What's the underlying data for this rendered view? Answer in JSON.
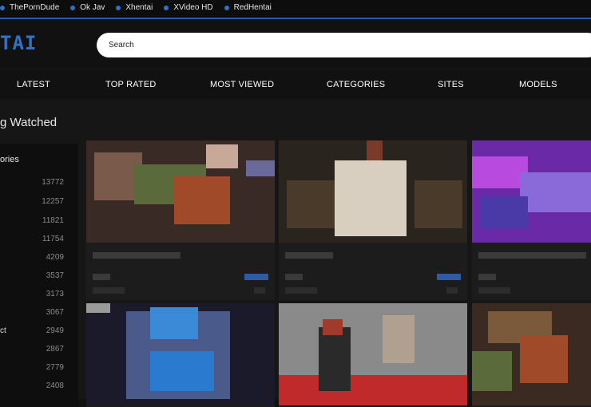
{
  "top_links": [
    "ThePornDude",
    "Ok Jav",
    "Xhentai",
    "XVideo HD",
    "RedHentai"
  ],
  "logo": "TAI",
  "search": {
    "placeholder": "Search"
  },
  "nav": [
    "LATEST",
    "TOP RATED",
    "MOST VIEWED",
    "CATEGORIES",
    "SITES",
    "MODELS"
  ],
  "section_title": "g Watched",
  "sidebar": {
    "title": "ories",
    "rows": [
      {
        "label": "",
        "count": "13772"
      },
      {
        "label": "",
        "count": "12257"
      },
      {
        "label": "",
        "count": "11821"
      },
      {
        "label": "",
        "count": "11754"
      },
      {
        "label": "",
        "count": "4209"
      },
      {
        "label": "",
        "count": "3537"
      },
      {
        "label": "",
        "count": "3173"
      },
      {
        "label": "",
        "count": "3067"
      },
      {
        "label": "ct",
        "count": "2949"
      },
      {
        "label": "",
        "count": "2867"
      },
      {
        "label": "",
        "count": "2779"
      },
      {
        "label": "",
        "count": "2408"
      }
    ]
  },
  "colors": {
    "accent": "#2f73c9",
    "background": "#111111"
  }
}
